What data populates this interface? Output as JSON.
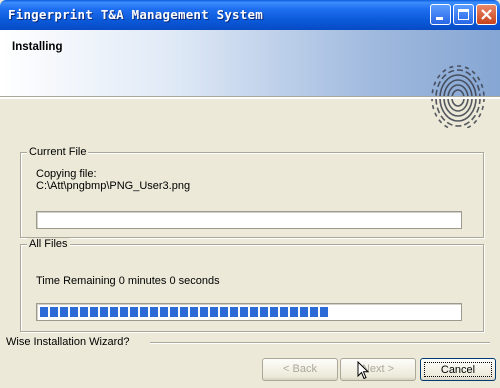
{
  "window": {
    "title": "Fingerprint T&A Management System"
  },
  "header": {
    "title": "Installing"
  },
  "current_file": {
    "legend": "Current File",
    "line1": "Copying file:",
    "line2": "C:\\Att\\pngbmp\\PNG_User3.png",
    "progress": 0
  },
  "all_files": {
    "legend": "All Files",
    "time_remaining": "Time Remaining 0 minutes 0 seconds",
    "progress": 0.7
  },
  "footer": {
    "brand": "Wise Installation Wizard?"
  },
  "buttons": {
    "back": "< Back",
    "next": "Next >",
    "cancel": "Cancel"
  },
  "colors": {
    "progress_fill": "#2c6bd6",
    "title_bar": "#0a58d8"
  }
}
